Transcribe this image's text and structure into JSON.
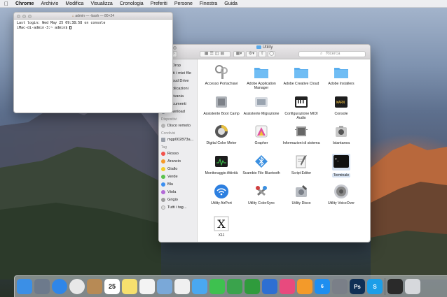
{
  "menubar": {
    "apple": "",
    "items": [
      "Chrome",
      "Archivio",
      "Modifica",
      "Visualizza",
      "Cronologia",
      "Preferiti",
      "Persone",
      "Finestra",
      "Guida"
    ]
  },
  "terminal": {
    "title": "admin — -bash — 80×24",
    "lines": [
      "Last login: Wed May 25 09:38:58 on console",
      "iMac-di-admin-3:~ admin$ "
    ]
  },
  "finder": {
    "title": "Utility",
    "search_placeholder": "Ricerca",
    "sidebar": {
      "favorites": [
        "AirDrop",
        "Tutti i miei file",
        "iCloud Drive",
        "Applicazioni",
        "Scrivania",
        "Documenti",
        "Download"
      ],
      "devices_head": "Dispositivi",
      "devices": [
        "Disco remoto"
      ],
      "shared_head": "Condivisi",
      "shared": [
        "mgp002873a..."
      ],
      "tags_head": "Tag",
      "tags": [
        {
          "label": "Rosso",
          "color": "#f2524c"
        },
        {
          "label": "Arancio",
          "color": "#f59a2a"
        },
        {
          "label": "Giallo",
          "color": "#f3cd2a"
        },
        {
          "label": "Verde",
          "color": "#5ac24d"
        },
        {
          "label": "Blu",
          "color": "#3c8ff0"
        },
        {
          "label": "Viola",
          "color": "#b36ad6"
        },
        {
          "label": "Grigio",
          "color": "#9d9d9d"
        },
        {
          "label": "Tutti i tag...",
          "color": "#dcdcdc"
        }
      ]
    },
    "apps": [
      {
        "label": "Accesso Portachiavi",
        "icon": "keychain-icon"
      },
      {
        "label": "Adobe Application Manager",
        "icon": "folder-icon"
      },
      {
        "label": "Adobe Creative Cloud",
        "icon": "folder-icon"
      },
      {
        "label": "Adobe Installers",
        "icon": "folder-icon"
      },
      {
        "label": "Assistente Boot Camp",
        "icon": "bootcamp-icon"
      },
      {
        "label": "Assistente Migrazione",
        "icon": "migration-icon"
      },
      {
        "label": "Configurazione MIDI Audio",
        "icon": "midi-icon"
      },
      {
        "label": "Console",
        "icon": "console-icon"
      },
      {
        "label": "Digital Color Meter",
        "icon": "color-meter-icon"
      },
      {
        "label": "Grapher",
        "icon": "grapher-icon"
      },
      {
        "label": "Informazioni di sistema",
        "icon": "system-info-icon"
      },
      {
        "label": "Istantanea",
        "icon": "screenshot-icon"
      },
      {
        "label": "Monitoraggio Attività",
        "icon": "activity-monitor-icon"
      },
      {
        "label": "Scambio File Bluetooth",
        "icon": "bluetooth-icon"
      },
      {
        "label": "Script Editor",
        "icon": "script-editor-icon"
      },
      {
        "label": "Terminale",
        "icon": "terminal-icon"
      },
      {
        "label": "Utility AirPort",
        "icon": "airport-icon"
      },
      {
        "label": "Utility ColorSync",
        "icon": "colorsync-icon"
      },
      {
        "label": "Utility Disco",
        "icon": "disk-utility-icon"
      },
      {
        "label": "Utility VoiceOver",
        "icon": "voiceover-icon"
      },
      {
        "label": "X11",
        "icon": "x11-icon"
      }
    ]
  },
  "dock": {
    "items": [
      {
        "name": "finder",
        "color": "#3b8fe6"
      },
      {
        "name": "launchpad",
        "color": "#6d7a8c"
      },
      {
        "name": "safari",
        "color": "#2f86e8"
      },
      {
        "name": "chrome",
        "color": "#e8e8e8"
      },
      {
        "name": "contacts",
        "color": "#b78a55"
      },
      {
        "name": "calendar",
        "color": "#ffffff",
        "text": "25"
      },
      {
        "name": "notes",
        "color": "#f6e06e"
      },
      {
        "name": "reminders",
        "color": "#f3f3f3"
      },
      {
        "name": "preview",
        "color": "#7aa8d8"
      },
      {
        "name": "photos",
        "color": "#f0f0f0"
      },
      {
        "name": "messages",
        "color": "#4aa8f0"
      },
      {
        "name": "facetime",
        "color": "#3ec14f"
      },
      {
        "name": "keynote-numbers",
        "color": "#3aa34c"
      },
      {
        "name": "numbers",
        "color": "#2f9b3c"
      },
      {
        "name": "keynote",
        "color": "#2d6fd2"
      },
      {
        "name": "itunes",
        "color": "#e84a7e"
      },
      {
        "name": "ibooks",
        "color": "#f39a2a"
      },
      {
        "name": "app-store",
        "color": "#1e8ef0",
        "text": "6"
      },
      {
        "name": "system-preferences",
        "color": "#7a7f88"
      },
      {
        "name": "photoshop",
        "color": "#0f2f55",
        "text": "Ps"
      },
      {
        "name": "skype",
        "color": "#1c9ee8",
        "text": "S"
      },
      {
        "name": "terminal",
        "color": "#2a2a2a"
      },
      {
        "name": "trash",
        "color": "#d6d8dc"
      }
    ]
  }
}
